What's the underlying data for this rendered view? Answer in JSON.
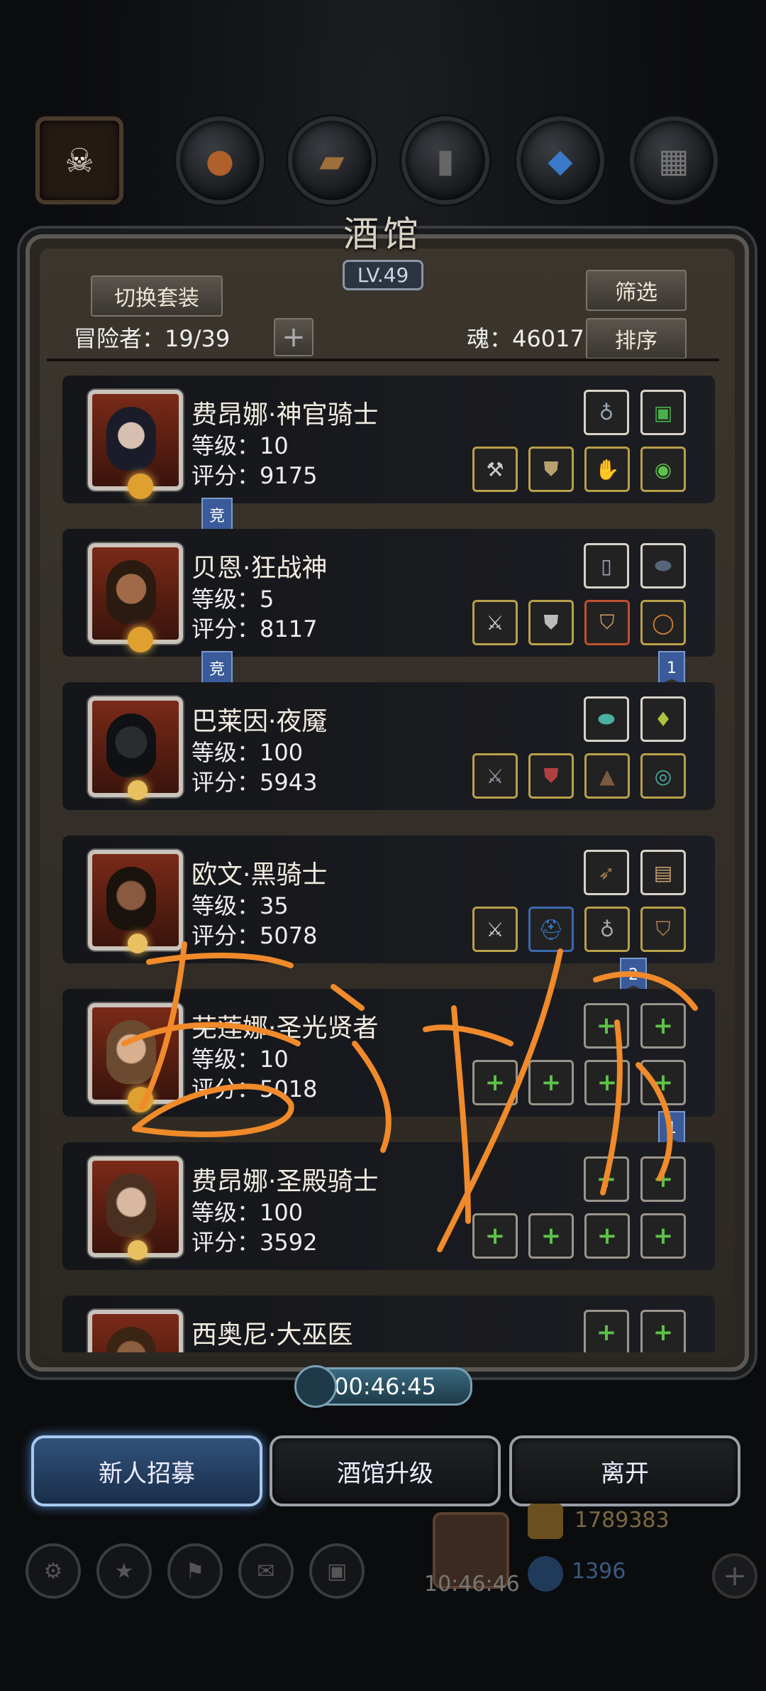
{
  "title": "酒馆",
  "level": "LV.49",
  "buttons": {
    "switch_outfit": "切换套装",
    "filter": "筛选",
    "sort": "排序",
    "add": "+"
  },
  "adventurers": "冒险者：19/39",
  "soul": "魂：46017",
  "heroes": [
    {
      "name": "费昂娜·神官骑士",
      "level": "等级：10",
      "score": "评分：9175",
      "flag": "竞"
    },
    {
      "name": "贝恩·狂战神",
      "level": "等级：5",
      "score": "评分：8117",
      "flag": "竞"
    },
    {
      "name": "巴莱因·夜魇",
      "level": "等级：100",
      "score": "评分：5943",
      "flag": "1"
    },
    {
      "name": "欧文·黑骑士",
      "level": "等级：35",
      "score": "评分：5078"
    },
    {
      "name": "芜莲娜·圣光贤者",
      "level": "等级：10",
      "score": "评分：5018",
      "flag": "2"
    },
    {
      "name": "费昂娜·圣殿骑士",
      "level": "等级：100",
      "score": "评分：3592",
      "flag": "1"
    },
    {
      "name": "西奥尼·大巫医"
    }
  ],
  "timer": "00:46:45",
  "bottom_buttons": {
    "recruit": "新人招募",
    "upgrade": "酒馆升级",
    "leave": "离开"
  },
  "dock": {
    "clock": "10:46:46",
    "gold": "1789383",
    "gems": "1396"
  },
  "colors": {
    "accent_blue": "#a8c8ee",
    "frame": "#5c5955",
    "scribble": "#f08a2a",
    "empty_slot_plus": "#5ec14a"
  }
}
